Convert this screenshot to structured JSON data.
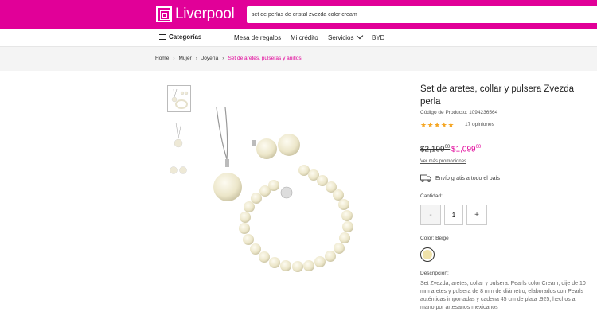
{
  "header": {
    "logo_text": "Liverpool",
    "search_value": "set de perlas de cristal zvezda color cream",
    "brand_color": "#e10098"
  },
  "nav": {
    "categories": "Categorías",
    "links": [
      "Mesa de regalos",
      "Mi crédito",
      "Servicios",
      "BYD"
    ]
  },
  "breadcrumb": {
    "items": [
      "Home",
      "Mujer",
      "Joyería"
    ],
    "current": "Set de aretes, pulseras y anillos"
  },
  "product": {
    "title": "Set de aretes, collar y pulsera Zvezda perla",
    "code": "Código de Producto: 1094236564",
    "rating": 5,
    "reviews": "17 opiniones",
    "price_old": "$2,199",
    "price_old_cents": "00",
    "price_new": "$1,099",
    "price_new_cents": "00",
    "promo_link": "Ver más promociones",
    "shipping": "Envío gratis a todo el país",
    "qty_label": "Cantidad:",
    "qty_minus": "-",
    "qty_value": "1",
    "qty_plus": "+",
    "color_label": "Color: Beige",
    "swatch_color": "#f0e2a9",
    "desc_label": "Descripción:",
    "description": "Set Zvezda, aretes, collar y pulsera. Pearls color Cream, dije de 10 mm aretes y pulsera de 8 mm de diámetro, elaborados con Pearls auténticas importadas y cadena 45 cm de plata .925, hechos a mano por artesanos mexicanos"
  },
  "icons": {
    "menu": "hamburger-icon",
    "chevron": "chevron-down-icon",
    "truck": "truck-icon",
    "star": "star-icon"
  }
}
